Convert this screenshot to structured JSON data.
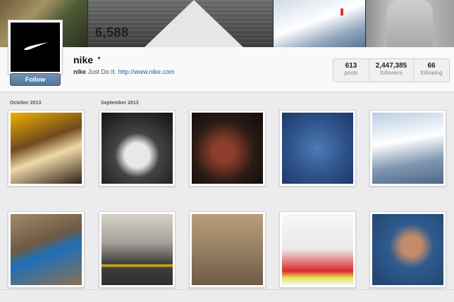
{
  "cover": {
    "count_text": "6,588"
  },
  "profile": {
    "username": "nike",
    "bio_name": "nike",
    "bio_text": "Just Do It.",
    "bio_link": "http://www.nike.com",
    "follow_label": "Follow",
    "stats": [
      {
        "value": "613",
        "label": "posts"
      },
      {
        "value": "2,447,385",
        "label": "followers"
      },
      {
        "value": "66",
        "label": "following"
      }
    ]
  },
  "feed": {
    "months": [
      "October 2013",
      "September 2013"
    ]
  },
  "colors": {
    "follow_button": "#5b7ea3",
    "link": "#2e5e8e",
    "background": "#ececee"
  }
}
